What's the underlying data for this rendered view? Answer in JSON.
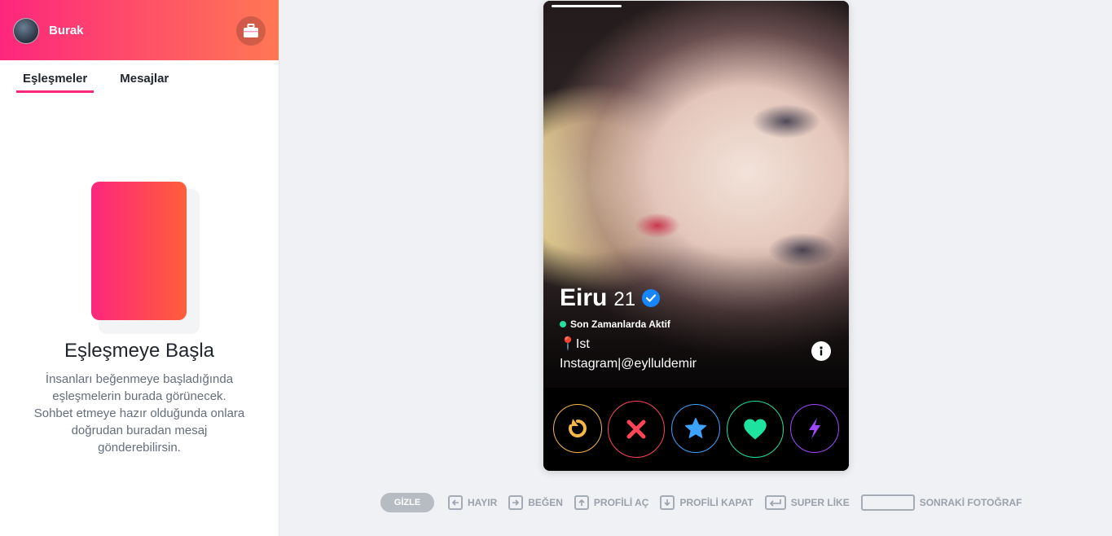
{
  "sidebar": {
    "user": {
      "name": "Burak"
    },
    "tabs": [
      {
        "label": "Eşleşmeler",
        "active": true
      },
      {
        "label": "Mesajlar",
        "active": false
      }
    ],
    "empty_state": {
      "title": "Eşleşmeye Başla",
      "description": "İnsanları beğenmeye başladığında eşleşmelerin burada görünecek. Sohbet etmeye hazır olduğunda onlara doğrudan buradan mesaj gönderebilirsin."
    }
  },
  "profile": {
    "name": "Eiru",
    "age": "21",
    "verified": true,
    "activity": "Son Zamanlarda Aktif",
    "bio_line1": "📍Ist",
    "bio_line2": "Instagram|@eylluldemir",
    "photo_index": 1,
    "photo_count": 4
  },
  "actions": [
    {
      "name": "rewind",
      "icon": "rewind-icon",
      "color": "#f5b748"
    },
    {
      "name": "nope",
      "icon": "x-icon",
      "color": "#ff4458"
    },
    {
      "name": "super-like",
      "icon": "star-icon",
      "color": "#3ca4ff"
    },
    {
      "name": "like",
      "icon": "heart-icon",
      "color": "#1ee3a0"
    },
    {
      "name": "boost",
      "icon": "lightning-icon",
      "color": "#a246ff"
    }
  ],
  "shortcuts": {
    "hide_label": "GİZLE",
    "items": [
      {
        "label": "HAYIR",
        "key": "arrow-left"
      },
      {
        "label": "BEĞEN",
        "key": "arrow-right"
      },
      {
        "label": "PROFİLİ AÇ",
        "key": "arrow-up"
      },
      {
        "label": "PROFİLİ KAPAT",
        "key": "arrow-down"
      },
      {
        "label": "SUPER LİKE",
        "key": "enter"
      },
      {
        "label": "SONRAKİ FOTOĞRAF",
        "key": "space"
      }
    ]
  },
  "colors": {
    "brand_gradient_start": "#fd267d",
    "brand_gradient_end": "#ff7854",
    "online": "#1ee3a0",
    "verified": "#1786ff"
  }
}
